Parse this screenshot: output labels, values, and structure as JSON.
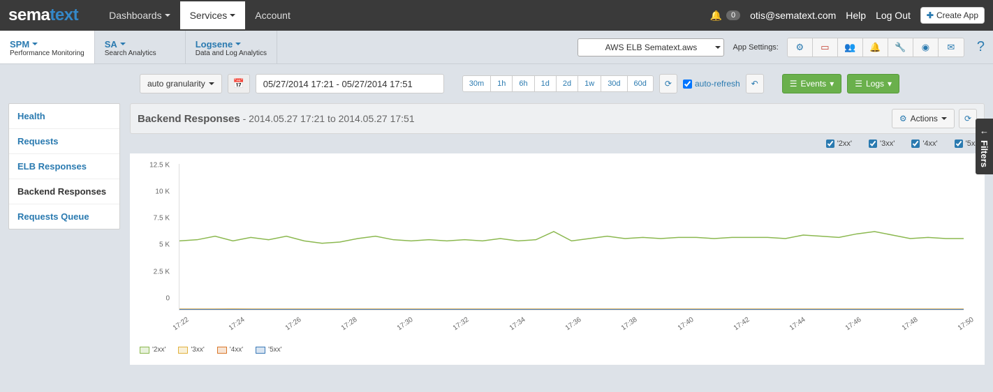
{
  "top": {
    "logo": {
      "part1": "sema",
      "part2": "text"
    },
    "nav": [
      {
        "label": "Dashboards",
        "dropdown": true,
        "active": false
      },
      {
        "label": "Services",
        "dropdown": true,
        "active": true
      },
      {
        "label": "Account",
        "dropdown": false,
        "active": false
      }
    ],
    "notification_count": "0",
    "user_email": "otis@sematext.com",
    "help": "Help",
    "logout": "Log Out",
    "create_app": "Create App"
  },
  "subnav": {
    "tabs": [
      {
        "title": "SPM",
        "subtitle": "Performance Monitoring",
        "active": true
      },
      {
        "title": "SA",
        "subtitle": "Search Analytics",
        "active": false
      },
      {
        "title": "Logsene",
        "subtitle": "Data and Log Analytics",
        "active": false
      }
    ],
    "app_selected": "AWS ELB Sematext.aws",
    "app_settings_label": "App Settings:"
  },
  "toolbar": {
    "granularity": "auto granularity",
    "date_range": "05/27/2014 17:21 - 05/27/2014 17:51",
    "ranges": [
      "30m",
      "1h",
      "6h",
      "1d",
      "2d",
      "1w",
      "30d",
      "60d"
    ],
    "auto_refresh": "auto-refresh",
    "events_btn": "Events",
    "logs_btn": "Logs"
  },
  "sidebar": [
    {
      "label": "Health",
      "active": false
    },
    {
      "label": "Requests",
      "active": false
    },
    {
      "label": "ELB Responses",
      "active": false
    },
    {
      "label": "Backend Responses",
      "active": true
    },
    {
      "label": "Requests Queue",
      "active": false
    }
  ],
  "panel": {
    "title": "Backend Responses",
    "range": " - 2014.05.27 17:21 to 2014.05.27 17:51",
    "actions_label": "Actions",
    "series_toggles": [
      "'2xx'",
      "'3xx'",
      "'4xx'",
      "'5xx'"
    ]
  },
  "legend": [
    {
      "label": "'2xx'",
      "color": "#8bb84f"
    },
    {
      "label": "'3xx'",
      "color": "#e1b23e"
    },
    {
      "label": "'4xx'",
      "color": "#d9772a"
    },
    {
      "label": "'5xx'",
      "color": "#3a79b7"
    }
  ],
  "filters_tab": "Filters",
  "chart_data": {
    "type": "line",
    "title": "Backend Responses",
    "ylabel": "",
    "xlabel": "",
    "ylim": [
      0,
      12500
    ],
    "y_ticks": [
      0,
      2500,
      5000,
      7500,
      10000,
      12500
    ],
    "y_tick_labels": [
      "0",
      "2.5 K",
      "5 K",
      "7.5 K",
      "10 K",
      "12.5 K"
    ],
    "x_ticks": [
      "17:22",
      "17:24",
      "17:26",
      "17:28",
      "17:30",
      "17:32",
      "17:34",
      "17:36",
      "17:38",
      "17:40",
      "17:42",
      "17:44",
      "17:46",
      "17:48",
      "17:50"
    ],
    "series": [
      {
        "name": "'2xx'",
        "color": "#8bb84f",
        "values": [
          5900,
          6000,
          6300,
          5900,
          6200,
          6000,
          6300,
          5900,
          5700,
          5800,
          6100,
          6300,
          6000,
          5900,
          6000,
          5900,
          6000,
          5900,
          6100,
          5900,
          6000,
          6700,
          5900,
          6100,
          6300,
          6100,
          6200,
          6100,
          6200,
          6200,
          6100,
          6200,
          6200,
          6200,
          6100,
          6400,
          6300,
          6200,
          6500,
          6700,
          6400,
          6100,
          6200,
          6100,
          6100
        ]
      },
      {
        "name": "'3xx'",
        "color": "#e1b23e",
        "values": [
          50,
          55,
          50,
          60,
          50,
          55,
          50,
          50,
          55,
          50,
          50,
          55,
          50,
          55,
          50,
          55,
          50,
          50,
          55,
          50,
          55,
          50,
          50,
          55,
          50,
          55,
          50,
          50,
          55,
          50,
          55,
          50,
          55,
          50,
          50,
          55,
          50,
          55,
          50,
          55,
          50,
          50,
          55,
          50,
          55
        ]
      },
      {
        "name": "'4xx'",
        "color": "#d9772a",
        "values": [
          20,
          22,
          20,
          25,
          20,
          22,
          20,
          20,
          20,
          22,
          20,
          20,
          22,
          20,
          22,
          20,
          20,
          22,
          20,
          20,
          22,
          20,
          22,
          20,
          20,
          22,
          20,
          22,
          20,
          20,
          22,
          20,
          20,
          22,
          20,
          22,
          20,
          20,
          22,
          20,
          22,
          20,
          20,
          22,
          20
        ]
      },
      {
        "name": "'5xx'",
        "color": "#3a79b7",
        "values": [
          5,
          5,
          6,
          5,
          5,
          5,
          6,
          5,
          5,
          5,
          5,
          6,
          5,
          5,
          5,
          6,
          5,
          5,
          5,
          5,
          6,
          5,
          5,
          5,
          6,
          5,
          5,
          5,
          5,
          6,
          5,
          5,
          5,
          6,
          5,
          5,
          5,
          5,
          6,
          5,
          5,
          5,
          5,
          6,
          5
        ]
      }
    ]
  }
}
